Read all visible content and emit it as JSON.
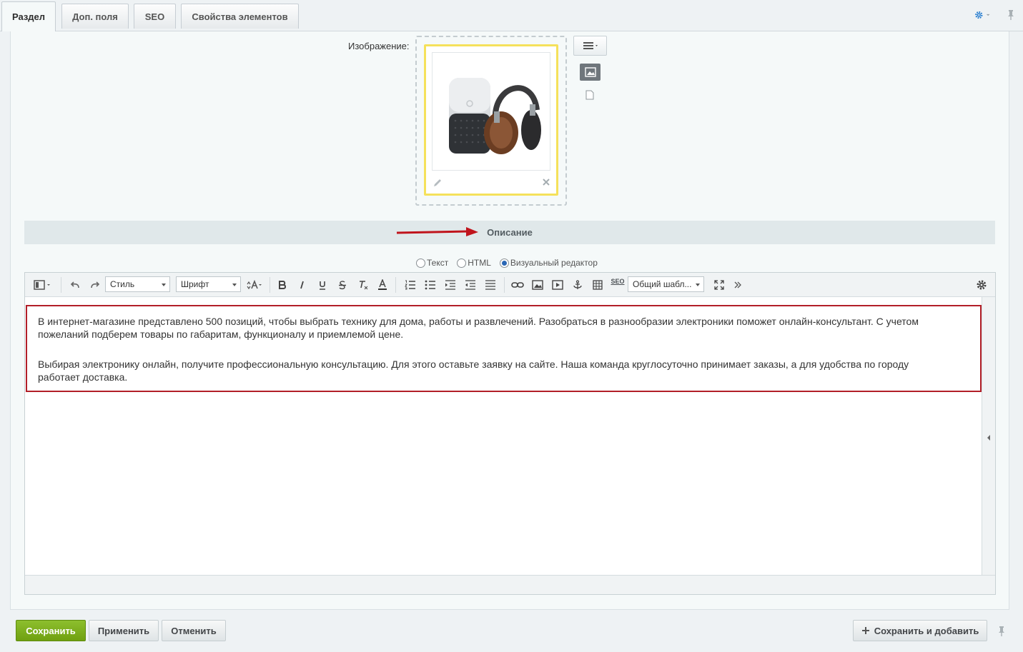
{
  "tabs": [
    {
      "label": "Раздел",
      "active": true
    },
    {
      "label": "Доп. поля",
      "active": false
    },
    {
      "label": "SEO",
      "active": false
    },
    {
      "label": "Свойства элементов",
      "active": false
    }
  ],
  "image_field": {
    "label": "Изображение:"
  },
  "section": {
    "title": "Описание"
  },
  "editor_modes": [
    {
      "label": "Текст",
      "checked": false
    },
    {
      "label": "HTML",
      "checked": false
    },
    {
      "label": "Визуальный редактор",
      "checked": true
    }
  ],
  "toolbar": {
    "style_select": "Стиль",
    "font_select": "Шрифт",
    "template_select": "Общий шабл...",
    "seo_label": "SEO"
  },
  "content": {
    "paragraph1": "В интернет-магазине представлено 500 позиций, чтобы выбрать технику для дома, работы и развлечений. Разобраться в разнообразии электроники поможет онлайн-консультант. С учетом пожеланий подберем товары по габаритам, функционалу и приемлемой цене.",
    "paragraph2": "Выбирая электронику онлайн, получите профессиональную консультацию. Для этого оставьте заявку на сайте. Наша команда круглосуточно принимает заказы, а для удобства по городу работает доставка."
  },
  "footer": {
    "save": "Сохранить",
    "apply": "Применить",
    "cancel": "Отменить",
    "save_and_add": "Сохранить и добавить"
  },
  "colors": {
    "highlight_border": "#b21f28",
    "arrow": "#c0141c",
    "save_button": "#7cae1c"
  }
}
